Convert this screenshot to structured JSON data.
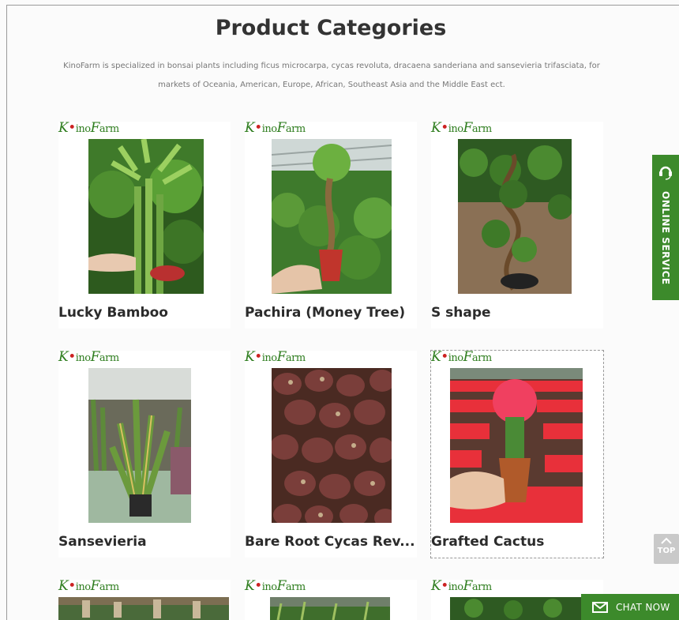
{
  "page": {
    "title": "Product Categories",
    "intro": "KinoFarm is specialized in bonsai plants including ficus microcarpa, cycas revoluta, dracaena sanderiana and sansevieria trifasciata, for markets of Oceania, American, Europe, African, Southeast Asia and the Middle East ect."
  },
  "brand": {
    "k": "K",
    "ino": "ino",
    "f": "F",
    "arm": "arm"
  },
  "products": [
    {
      "name": "Lucky Bamboo"
    },
    {
      "name": "Pachira (Money Tree)"
    },
    {
      "name": "S shape"
    },
    {
      "name": "Sansevieria"
    },
    {
      "name": "Bare Root Cycas Rev..."
    },
    {
      "name": "Grafted Cactus"
    }
  ],
  "widgets": {
    "online_service": "ONLINE SERVICE",
    "top": "TOP",
    "chat_now": "CHAT NOW"
  },
  "colors": {
    "brand_green": "#3c8a2b",
    "brand_red": "#cc2222"
  }
}
